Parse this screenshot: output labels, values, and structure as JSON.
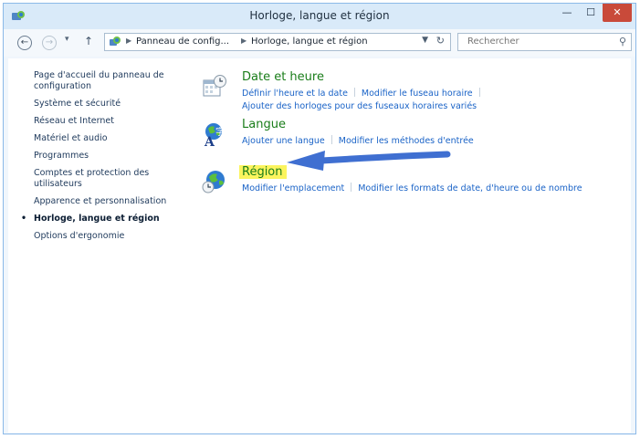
{
  "window": {
    "title": "Horloge, langue et région",
    "buttons": {
      "minimize": "—",
      "maximize": "☐",
      "close": "✕"
    }
  },
  "navbar": {
    "back": "←",
    "forward": "→",
    "history": "▾",
    "up": "↑",
    "breadcrumb": [
      "Panneau de config...",
      "Horloge, langue et région"
    ],
    "search_placeholder": "Rechercher"
  },
  "sidebar": {
    "items": [
      {
        "label": "Page d'accueil du panneau de configuration"
      },
      {
        "label": "Système et sécurité"
      },
      {
        "label": "Réseau et Internet"
      },
      {
        "label": "Matériel et audio"
      },
      {
        "label": "Programmes"
      },
      {
        "label": "Comptes et protection des utilisateurs"
      },
      {
        "label": "Apparence et personnalisation"
      },
      {
        "label": "Horloge, langue et région",
        "active": true
      },
      {
        "label": "Options d'ergonomie"
      }
    ]
  },
  "categories": [
    {
      "title": "Date et heure",
      "icon": "calendar-clock-icon",
      "links": [
        "Définir l'heure et la date",
        "Modifier le fuseau horaire",
        "Ajouter des horloges pour des fuseaux horaires variés"
      ]
    },
    {
      "title": "Langue",
      "icon": "language-globe-icon",
      "links": [
        "Ajouter une langue",
        "Modifier les méthodes d'entrée"
      ]
    },
    {
      "title": "Région",
      "icon": "region-globe-icon",
      "highlight_color": "#fbf45e",
      "links": [
        "Modifier l'emplacement",
        "Modifier les formats de date, d'heure ou de nombre"
      ]
    }
  ],
  "annotation": {
    "arrow_color": "#3f6fd1"
  }
}
